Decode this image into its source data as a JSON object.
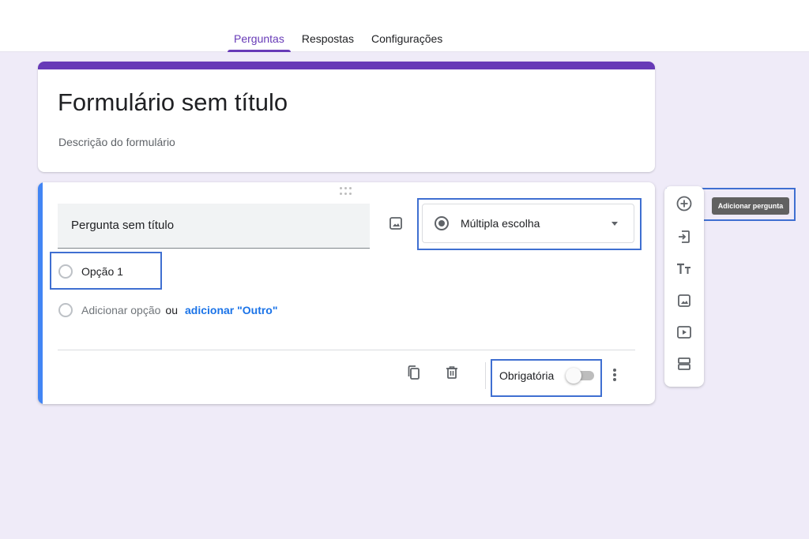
{
  "tabs": [
    {
      "label": "Perguntas",
      "active": true
    },
    {
      "label": "Respostas",
      "active": false
    },
    {
      "label": "Configurações",
      "active": false
    }
  ],
  "form": {
    "title": "Formulário sem título",
    "description": "Descrição do formulário"
  },
  "question": {
    "title": "Pergunta sem título",
    "type": "Múltipla escolha",
    "options": [
      "Opção 1"
    ],
    "add_option": "Adicionar opção",
    "or": "ou",
    "add_other": "adicionar \"Outro\"",
    "required_label": "Obrigatória",
    "required": false
  },
  "toolbar": {
    "items": [
      "add-circle-icon",
      "import-icon",
      "title-text-icon",
      "image-icon",
      "video-icon",
      "section-icon"
    ],
    "tooltip": "Adicionar pergunta"
  },
  "colors": {
    "accent": "#673ab7",
    "focus": "#4285f4",
    "highlight": "#3f6fd1",
    "background": "#efebf8"
  }
}
